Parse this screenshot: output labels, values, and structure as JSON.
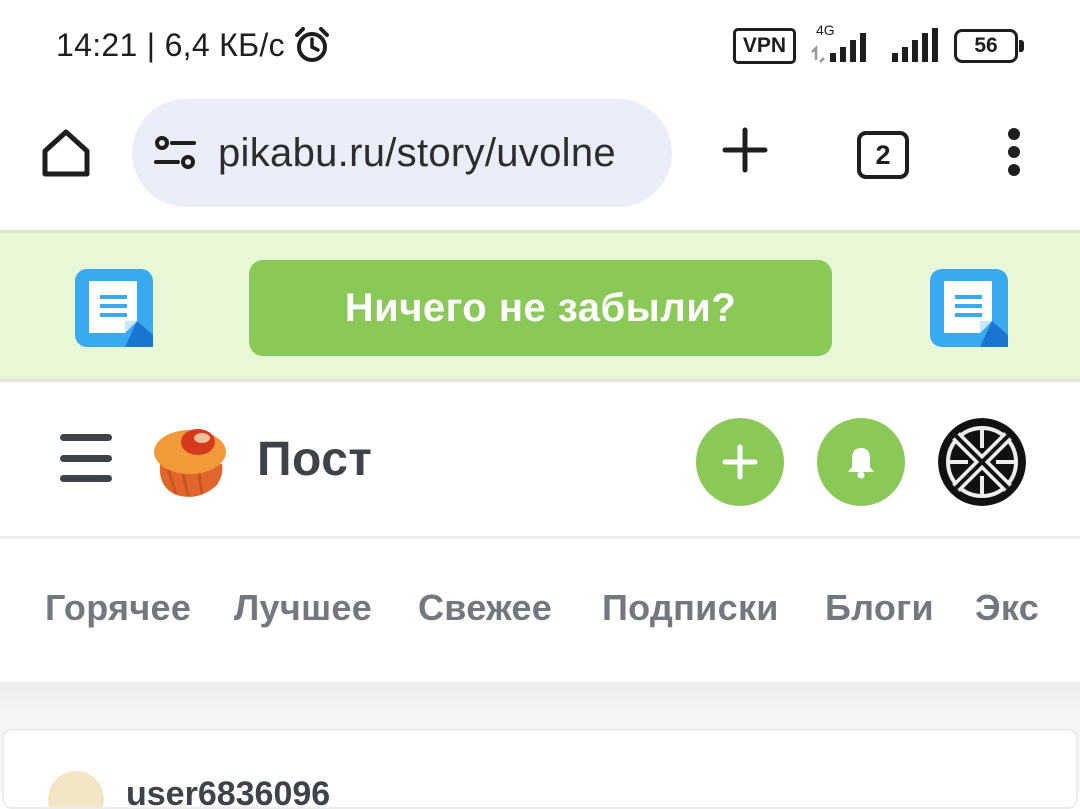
{
  "status_bar": {
    "time_speed": "14:21 | 6,4 КБ/с",
    "vpn": "VPN",
    "network": "4G",
    "battery": "56",
    "alarm_icon": "alarm-clock-icon",
    "signal_icon": "signal-bars-icon"
  },
  "browser": {
    "url": "pikabu.ru/story/uvolne",
    "tab_count": "2",
    "home_icon": "home-icon",
    "site_settings_icon": "tune-icon",
    "new_tab_icon": "plus-icon",
    "menu_icon": "kebab-menu-icon"
  },
  "banner": {
    "button_label": "Ничего не забыли?",
    "icon": "notes-app-icon",
    "background": "#e8f8d6",
    "button_color": "#8ac858"
  },
  "header": {
    "title": "Пост",
    "menu_icon": "hamburger-icon",
    "logo_icon": "pikabu-cupcake-logo",
    "add_icon": "plus-icon",
    "bell_icon": "bell-icon",
    "accent": "#8ac858"
  },
  "nav": {
    "tabs": [
      "Горячее",
      "Лучшее",
      "Свежее",
      "Подписки",
      "Блоги",
      "Экс"
    ]
  },
  "post": {
    "author": "user6836096"
  }
}
